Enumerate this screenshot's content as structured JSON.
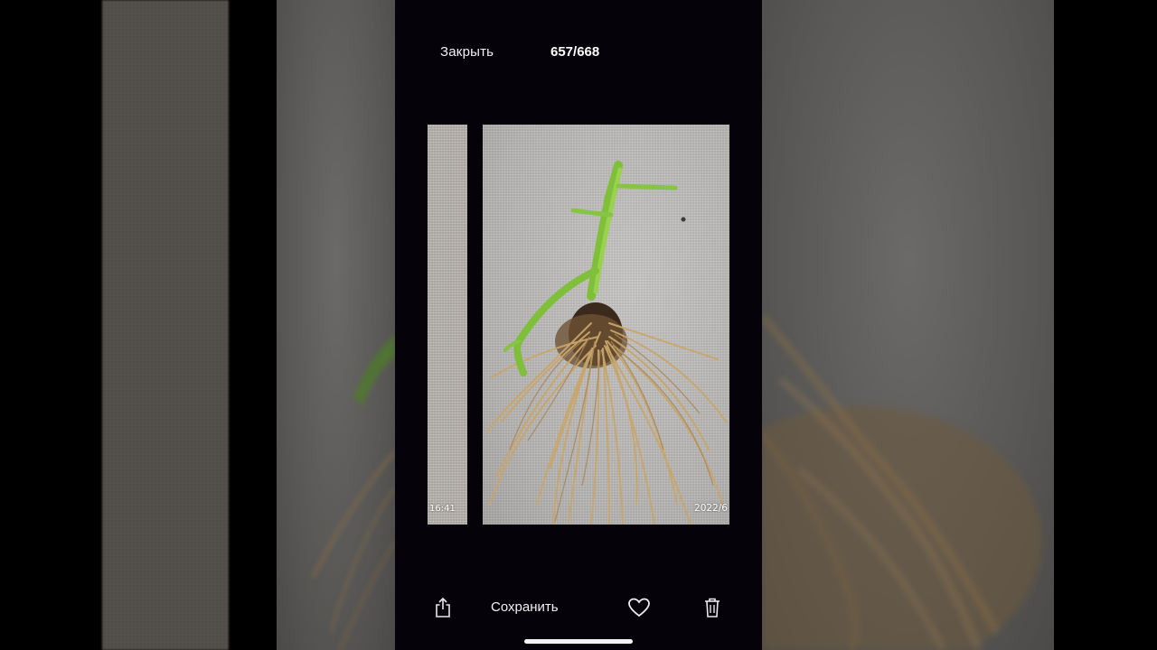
{
  "header": {
    "close_label": "Закрыть",
    "counter": "657/668"
  },
  "photos": {
    "previous_timestamp": "16:41",
    "current_date_stamp": "2022/6"
  },
  "toolbar": {
    "share_icon": "share-icon",
    "save_label": "Сохранить",
    "favorite_icon": "heart-icon",
    "delete_icon": "trash-icon"
  },
  "colors": {
    "viewer_background": "#05020a",
    "text": "#f2f2f2",
    "stem_green": "#7fbf3a",
    "root_tan": "#c9a66b"
  }
}
